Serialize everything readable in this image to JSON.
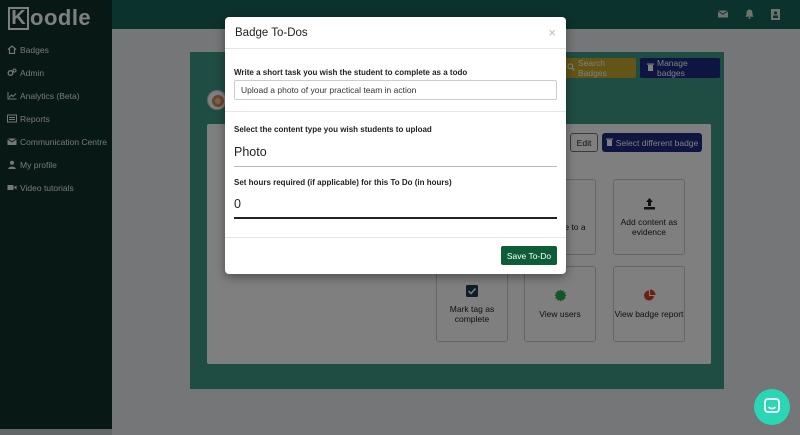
{
  "app": {
    "logo_first": "K",
    "logo_rest": "oodle"
  },
  "sidebar": {
    "items": [
      {
        "label": "Badges",
        "icon": "home-icon"
      },
      {
        "label": "Admin",
        "icon": "cogs-icon"
      },
      {
        "label": "Analytics (Beta)",
        "icon": "line-chart-icon"
      },
      {
        "label": "Reports",
        "icon": "list-icon"
      },
      {
        "label": "Communication Centre",
        "icon": "envelope-icon"
      },
      {
        "label": "My profile",
        "icon": "user-icon"
      },
      {
        "label": "Video tutorials",
        "icon": "video-icon"
      }
    ]
  },
  "topbar": {
    "icons": [
      "envelope-icon",
      "bell-icon",
      "user-card-icon"
    ]
  },
  "main": {
    "search_badges_label": "Search Badges",
    "manage_badges_label": "Manage badges",
    "edit_label": "Edit",
    "select_badge_label": "Select different badge",
    "tiles": {
      "partial_label": "e to a",
      "add_content_label": "Add content as evidence",
      "mark_tag_label": "Mark tag as complete",
      "view_users_label": "View users",
      "view_report_label": "View badge report"
    }
  },
  "modal": {
    "title": "Badge To-Dos",
    "close": "×",
    "task_label": "Write a short task you wish the student to complete as a todo",
    "task_value": "Upload a photo of your practical team in action",
    "content_type_label": "Select the content type you wish students to upload",
    "content_type_value": "Photo",
    "hours_label": "Set hours required (if applicable) for this To Do (in hours)",
    "hours_value": "0",
    "save_label": "Save To-Do"
  },
  "colors": {
    "sidebar": "#10302a",
    "topbar": "#17655a",
    "save_button": "#0e5d39",
    "manage_button": "#1b2a80",
    "search_button": "#c6ab2a",
    "chat_widget": "#2ad6b4"
  }
}
